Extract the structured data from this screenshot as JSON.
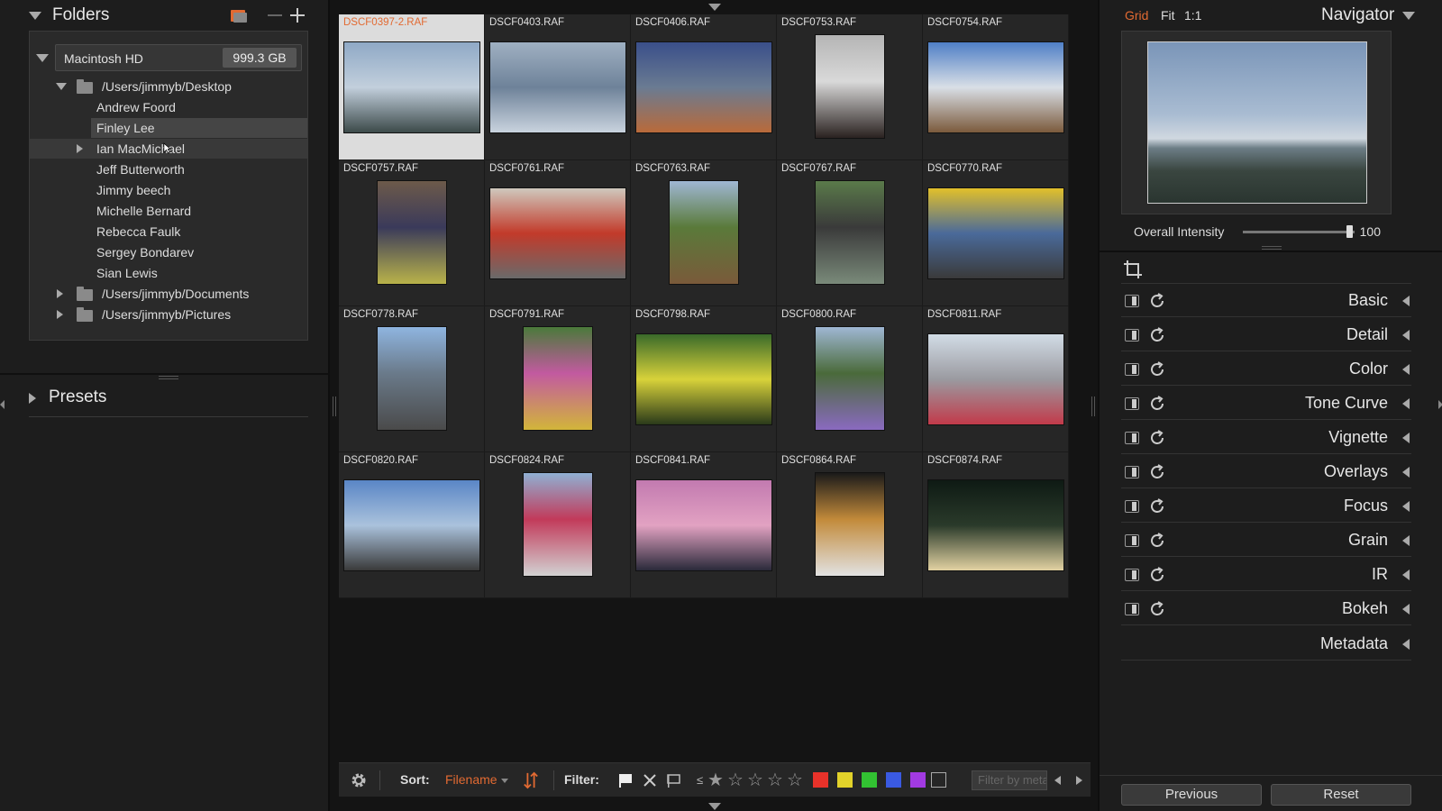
{
  "folders": {
    "title": "Folders",
    "drive": {
      "name": "Macintosh HD",
      "size": "999.3 GB"
    },
    "tree": [
      {
        "label": "/Users/jimmyb/Desktop",
        "type": "folder",
        "expanded": true
      },
      {
        "label": "Andrew Foord",
        "type": "item"
      },
      {
        "label": "Finley Lee",
        "type": "item",
        "selected": true
      },
      {
        "label": "Ian MacMichael",
        "type": "item",
        "hover": true,
        "has_children": true
      },
      {
        "label": "Jeff Butterworth",
        "type": "item"
      },
      {
        "label": "Jimmy beech",
        "type": "item"
      },
      {
        "label": "Michelle Bernard",
        "type": "item"
      },
      {
        "label": "Rebecca Faulk",
        "type": "item"
      },
      {
        "label": "Sergey Bondarev",
        "type": "item"
      },
      {
        "label": "Sian Lewis",
        "type": "item"
      },
      {
        "label": "/Users/jimmyb/Documents",
        "type": "folder",
        "expanded": false
      },
      {
        "label": "/Users/jimmyb/Pictures",
        "type": "folder",
        "expanded": false
      }
    ]
  },
  "presets": {
    "title": "Presets"
  },
  "grid": {
    "photos": [
      {
        "name": "DSCF0397-2.RAF",
        "selected": true,
        "orient": "landscape",
        "colors": [
          "#8fa9c6",
          "#c2cfdc",
          "#3c4a4a"
        ]
      },
      {
        "name": "DSCF0403.RAF",
        "orient": "landscape",
        "colors": [
          "#9fb0c2",
          "#6e8299",
          "#c9d3de"
        ]
      },
      {
        "name": "DSCF0406.RAF",
        "orient": "landscape",
        "colors": [
          "#3a4f8a",
          "#6a7b92",
          "#b96a3a"
        ]
      },
      {
        "name": "DSCF0753.RAF",
        "orient": "portrait",
        "colors": [
          "#b5b5b5",
          "#2a2220",
          "#d9d9d9"
        ]
      },
      {
        "name": "DSCF0754.RAF",
        "orient": "landscape",
        "colors": [
          "#4f7fc6",
          "#d9dfe6",
          "#7b5a3c"
        ]
      },
      {
        "name": "DSCF0757.RAF",
        "orient": "portrait",
        "colors": [
          "#6d5a4a",
          "#b9b34a",
          "#3a3a5a"
        ]
      },
      {
        "name": "DSCF0761.RAF",
        "orient": "landscape",
        "colors": [
          "#cfc8bd",
          "#c23a2a",
          "#6a6a6a"
        ]
      },
      {
        "name": "DSCF0763.RAF",
        "orient": "portrait",
        "colors": [
          "#9fb7d3",
          "#7a5a3a",
          "#5a7a3a"
        ]
      },
      {
        "name": "DSCF0767.RAF",
        "orient": "portrait",
        "colors": [
          "#5a7a4a",
          "#7a8a7a",
          "#3a3a3a"
        ]
      },
      {
        "name": "DSCF0770.RAF",
        "orient": "landscape",
        "colors": [
          "#e2c02a",
          "#4a6a9a",
          "#3a3a3a"
        ]
      },
      {
        "name": "DSCF0778.RAF",
        "orient": "portrait",
        "colors": [
          "#8fb5e0",
          "#4a4a4a",
          "#6a7a8a"
        ]
      },
      {
        "name": "DSCF0791.RAF",
        "orient": "portrait",
        "colors": [
          "#4a7a3a",
          "#d2b53a",
          "#c25aa0"
        ]
      },
      {
        "name": "DSCF0798.RAF",
        "orient": "landscape",
        "colors": [
          "#3a6a2a",
          "#d8d23a",
          "#2a3a1a"
        ]
      },
      {
        "name": "DSCF0800.RAF",
        "orient": "portrait",
        "colors": [
          "#9fb7d3",
          "#8a6ac0",
          "#4a6a3a"
        ]
      },
      {
        "name": "DSCF0811.RAF",
        "orient": "landscape",
        "colors": [
          "#d2dce6",
          "#9a9aa0",
          "#c23a4a"
        ]
      },
      {
        "name": "DSCF0820.RAF",
        "orient": "landscape",
        "colors": [
          "#5a86c6",
          "#aac2dc",
          "#3a3a3a"
        ]
      },
      {
        "name": "DSCF0824.RAF",
        "orient": "portrait",
        "colors": [
          "#8fb0d3",
          "#d2d2d2",
          "#c23a5a"
        ]
      },
      {
        "name": "DSCF0841.RAF",
        "orient": "landscape",
        "colors": [
          "#c27ab0",
          "#e2a2c2",
          "#2a2a3a"
        ]
      },
      {
        "name": "DSCF0864.RAF",
        "orient": "portrait",
        "colors": [
          "#1a1a1a",
          "#e2e2e2",
          "#c28a3a"
        ]
      },
      {
        "name": "DSCF0874.RAF",
        "orient": "landscape",
        "colors": [
          "#0e1a14",
          "#2a3a2a",
          "#e2d2a2"
        ]
      }
    ]
  },
  "toolbar": {
    "sort_label": "Sort:",
    "sort_value": "Filename",
    "filter_label": "Filter:",
    "rating_prefix": "≤",
    "filter_placeholder": "Filter by metadata",
    "color_labels": [
      "#e8322a",
      "#e2d22a",
      "#32c232",
      "#3a5ae2",
      "#a23ae2"
    ]
  },
  "navigator": {
    "tabs": [
      "Grid",
      "Fit",
      "1:1"
    ],
    "active_tab": "Grid",
    "title": "Navigator",
    "intensity_label": "Overall Intensity",
    "intensity_value": "100"
  },
  "modules": [
    "Basic",
    "Detail",
    "Color",
    "Tone Curve",
    "Vignette",
    "Overlays",
    "Focus",
    "Grain",
    "IR",
    "Bokeh"
  ],
  "metadata_label": "Metadata",
  "buttons": {
    "previous": "Previous",
    "reset": "Reset"
  },
  "accent": "#e26a32"
}
